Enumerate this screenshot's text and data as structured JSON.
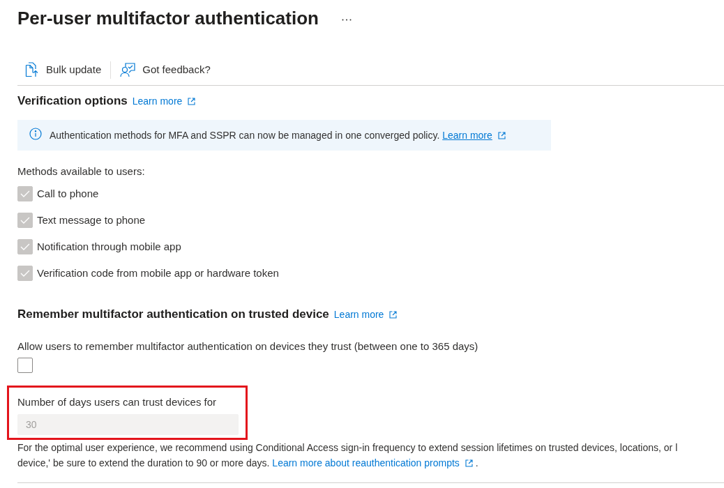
{
  "page": {
    "title": "Per-user multifactor authentication"
  },
  "toolbar": [
    {
      "kind": "bulk_update",
      "label": "Bulk update"
    },
    {
      "kind": "feedback",
      "label": "Got feedback?"
    }
  ],
  "verification_options": {
    "heading": "Verification options",
    "learn_more": "Learn more",
    "banner": {
      "text": "Authentication methods for MFA and SSPR can now be managed in one converged policy.",
      "link": "Learn more"
    },
    "methods_label": "Methods available to users:",
    "methods": [
      {
        "label": "Call to phone",
        "checked": true,
        "disabled": true
      },
      {
        "label": "Text message to phone",
        "checked": true,
        "disabled": true
      },
      {
        "label": "Notification through mobile app",
        "checked": true,
        "disabled": true
      },
      {
        "label": "Verification code from mobile app or hardware token",
        "checked": true,
        "disabled": true
      }
    ]
  },
  "remember_device": {
    "heading": "Remember multifactor authentication on trusted device",
    "learn_more": "Learn more",
    "allow_label": "Allow users to remember multifactor authentication on devices they trust (between one to 365 days)",
    "allow_checked": false,
    "days": {
      "label": "Number of days users can trust devices for",
      "value": "30",
      "disabled": true,
      "highlighted": true
    },
    "note": {
      "line_1": "For the optimal user experience, we recommend using Conditional Access sign-in frequency to extend session lifetimes on trusted devices, locations, or l",
      "line_2": "device,' be sure to extend the duration to 90 or more days.",
      "link": "Learn more about reauthentication prompts",
      "end": "."
    }
  }
}
